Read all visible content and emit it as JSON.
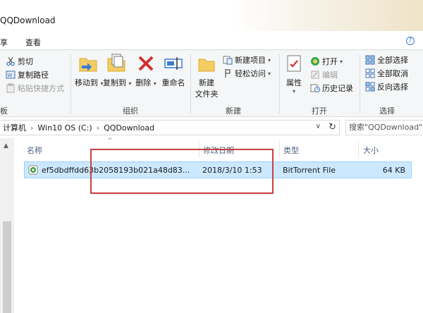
{
  "window": {
    "title": "QQDownload"
  },
  "tabs": [
    "享",
    "查看"
  ],
  "ribbon": {
    "clipboard": {
      "cut": "剪切",
      "copy_path": "复制路径",
      "paste_shortcut": "粘贴快捷方式",
      "group_label": "板"
    },
    "organize": {
      "move_to": "移动到",
      "copy_to": "复制到",
      "delete": "删除",
      "rename": "重命名",
      "group_label": "组织"
    },
    "new": {
      "new_folder_line1": "新建",
      "new_folder_line2": "文件夹",
      "new_item": "新建项目",
      "easy_access": "轻松访问",
      "group_label": "新建"
    },
    "open": {
      "properties": "属性",
      "open": "打开",
      "edit": "编辑",
      "history": "历史记录",
      "group_label": "打开"
    },
    "select": {
      "select_all": "全部选择",
      "select_none": "全部取消",
      "invert": "反向选择",
      "group_label": "选择"
    }
  },
  "address": {
    "crumbs": [
      "计算机",
      "Win10 OS (C:)",
      "QQDownload"
    ],
    "search_placeholder": "搜索\"QQDownload\""
  },
  "columns": {
    "name": "名称",
    "date": "修改日期",
    "type": "类型",
    "size": "大小"
  },
  "files": [
    {
      "name": "ef5dbdffdd63b2058193b021a48d83...",
      "date": "2018/3/10 1:53",
      "type": "BitTorrent File",
      "size": "64 KB"
    }
  ],
  "colors": {
    "selection_bg": "#cce8ff",
    "selection_border": "#99d1ff",
    "annotation": "#c9403f",
    "header_text": "#4d6082"
  },
  "icons": [
    "scissors-icon",
    "copy-path-icon",
    "paste-shortcut-icon",
    "move-to-icon",
    "copy-to-icon",
    "delete-icon",
    "rename-icon",
    "new-folder-icon",
    "new-item-icon",
    "easy-access-icon",
    "properties-icon",
    "open-icon",
    "edit-icon",
    "history-icon",
    "select-all-icon",
    "select-none-icon",
    "invert-selection-icon",
    "torrent-file-icon",
    "refresh-icon",
    "chevron-down-icon"
  ]
}
